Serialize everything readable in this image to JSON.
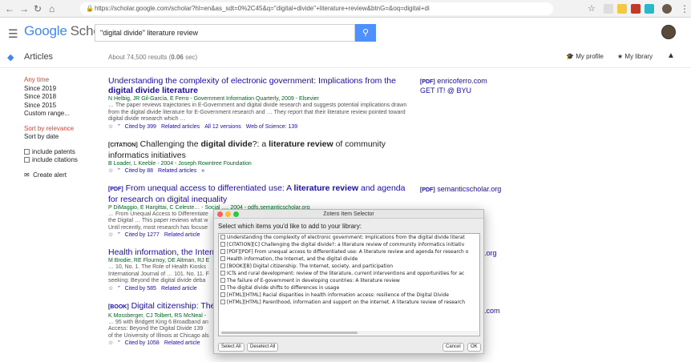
{
  "browser": {
    "url": "https://scholar.google.com/scholar?hl=en&as_sdt=0%2C45&q=\"digital+divide\"+literature+review&btnG=&oq=digital+di"
  },
  "header": {
    "logo_google": "Google",
    "logo_scholar": "Scholar",
    "search_value": "\"digital divide\" literature review"
  },
  "subbar": {
    "section": "Articles",
    "count_prefix": "About 74,500 results (",
    "count_time": "0.06",
    "count_suffix": " sec)",
    "my_profile": "My profile",
    "my_library": "My library"
  },
  "sidebar": {
    "time_filters": [
      "Any time",
      "Since 2019",
      "Since 2018",
      "Since 2015",
      "Custom range..."
    ],
    "sort": [
      "Sort by relevance",
      "Sort by date"
    ],
    "include_patents": "include patents",
    "include_citations": "include citations",
    "create_alert": "Create alert"
  },
  "results": [
    {
      "title_a": "Understanding the complexity of electronic government: Implications from the ",
      "title_b": "digital divide literature",
      "authors": "N Helbig, JR Gil-García, E Ferro - Government Information Quarterly, 2009 - Elsevier",
      "snippet": "… The paper reviews trajectories in E-Government and digital divide research and suggests potential implications drawn from the digital divide literature for E-Government research and … They report that their literature review pointed toward digital divide research which …",
      "footer": [
        "Cited by 399",
        "Related articles",
        "All 12 versions",
        "Web of Science: 139"
      ]
    },
    {
      "tag": "[CITATION]",
      "title_a": "Challenging the ",
      "title_b": "digital divide",
      "title_c": "?: a ",
      "title_d": "literature review",
      "title_e": " of community informatics initiatives",
      "authors": "B Loader, L Keeble - 2004 - Joseph Rowntree Foundation",
      "footer": [
        "Cited by 88",
        "Related articles"
      ]
    },
    {
      "tag": "[PDF]",
      "title_a": "From unequal access to differentiated use: A ",
      "title_b": "literature review",
      "title_c": " and agenda for research on digital inequality",
      "authors": "P DiMaggio, E Hargittai, C Celeste… - Social …, 2004 - pdfs.semanticscholar.org",
      "snippet_lines": [
        "… From Unequal Access to Differentiate",
        "the Digital … This paper reviews what w",
        "Until recently, most research has focuse"
      ],
      "footer": [
        "Cited by 1277",
        "Related article"
      ]
    },
    {
      "title": "Health information, the Internet",
      "authors": "M Brodie, RE Flournoy, DE Altman, RJ E",
      "snippet_lines": [
        "… 10, No. 1. The Role of Health Kiosks",
        "International Journal of … 101. No. 11. F",
        "seeking: Beyond the digital divide deba"
      ],
      "footer": [
        "Cited by 585",
        "Related article"
      ]
    },
    {
      "tag": "[BOOK]",
      "title": "Digital citizenship: The In",
      "authors": "K Mossberger, CJ Tolbert, RS McNeal -",
      "snippet_lines": [
        "… 95 with Bridgett King 6 Broadband an",
        "Access: Beyond the Digital Divide 139",
        "of the University of Illinois at Chicago als"
      ],
      "footer": [
        "Cited by 1058",
        "Related article"
      ]
    }
  ],
  "side_links": [
    {
      "tag": "[PDF]",
      "text": "enricoferro.com"
    },
    {
      "text": "GET IT! @ BYU"
    },
    {
      "tag": "[PDF]",
      "text": "semanticscholar.org"
    },
    {
      "text": ".org"
    },
    {
      "text": ".com"
    }
  ],
  "zotero": {
    "title": "Zotero Item Selector",
    "prompt": "Select which items you'd like to add to your library:",
    "items": [
      "Understanding the complexity of electronic government: Implications from the digital divide literat",
      "[CITATION][C] Challenging the digital divide?: a literature review of community informatics initiativ",
      "[PDF][PDF] From unequal access to differentiated use: A literature review and agenda for research o",
      "Health information, the Internet, and the digital divide",
      "[BOOK][B] Digital citizenship: The Internet, society, and participation",
      "ICTs and rural development: review of the literature, current interventions and opportunities for ac",
      "The failure of E-government in developing countries: A literature review",
      "The digital divide shifts to differences in usage",
      "[HTML][HTML] Racial disparities in health information access: resilience of the Digital Divide",
      "[HTML][HTML] Parenthood, information and support on the internet. A literature review of research"
    ],
    "select_all": "Select All",
    "deselect_all": "Deselect All",
    "cancel": "Cancel",
    "ok": "OK"
  }
}
